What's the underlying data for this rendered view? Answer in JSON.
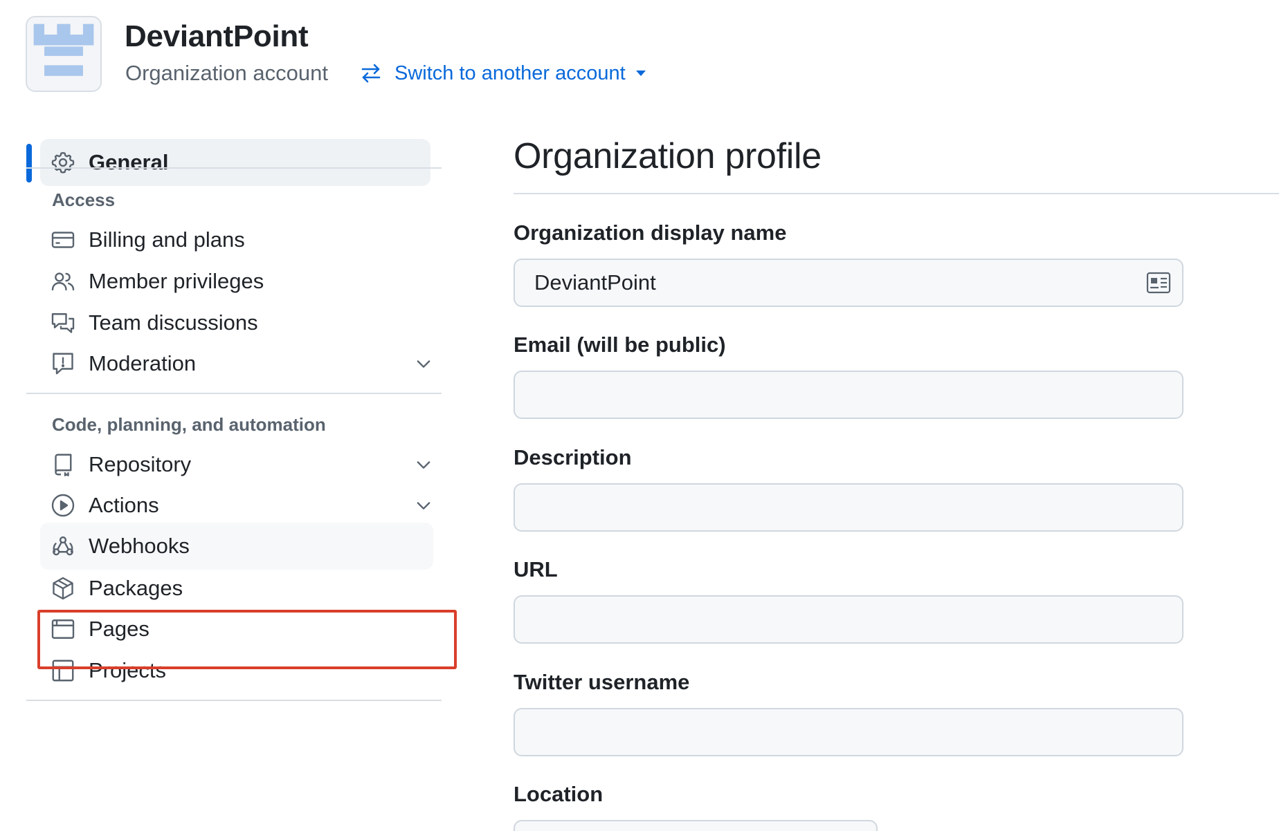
{
  "header": {
    "org_name": "DeviantPoint",
    "org_subtitle": "Organization account",
    "switch_account_label": "Switch to another account"
  },
  "sidebar": {
    "general": {
      "label": "General",
      "icon": "gear-icon",
      "active": true
    },
    "sections": [
      {
        "heading": "Access",
        "items": [
          {
            "label": "Billing and plans",
            "icon": "credit-card-icon",
            "expandable": false
          },
          {
            "label": "Member privileges",
            "icon": "people-icon",
            "expandable": false
          },
          {
            "label": "Team discussions",
            "icon": "comment-discussion-icon",
            "expandable": false
          },
          {
            "label": "Moderation",
            "icon": "report-icon",
            "expandable": true
          }
        ]
      },
      {
        "heading": "Code, planning, and automation",
        "items": [
          {
            "label": "Repository",
            "icon": "repo-icon",
            "expandable": true
          },
          {
            "label": "Actions",
            "icon": "play-icon",
            "expandable": true
          },
          {
            "label": "Webhooks",
            "icon": "webhook-icon",
            "expandable": false,
            "highlighted": true
          },
          {
            "label": "Packages",
            "icon": "package-icon",
            "expandable": false
          },
          {
            "label": "Pages",
            "icon": "browser-icon",
            "expandable": false
          },
          {
            "label": "Projects",
            "icon": "table-icon",
            "expandable": false
          }
        ]
      }
    ]
  },
  "main": {
    "title": "Organization profile",
    "fields": [
      {
        "label": "Organization display name",
        "value": "DeviantPoint"
      },
      {
        "label": "Email (will be public)",
        "value": ""
      },
      {
        "label": "Description",
        "value": ""
      },
      {
        "label": "URL",
        "value": ""
      },
      {
        "label": "Twitter username",
        "value": ""
      },
      {
        "label": "Location",
        "value": ""
      }
    ]
  },
  "colors": {
    "accent": "#0969da",
    "highlight_outline": "#d93f2b",
    "input_background": "#f6f8fa"
  }
}
